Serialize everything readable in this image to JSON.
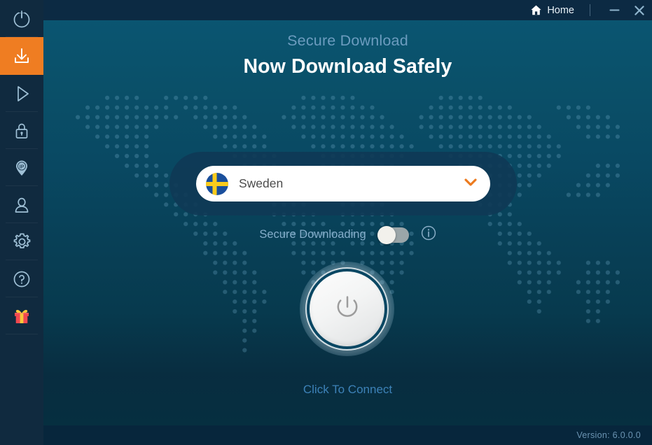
{
  "window": {
    "home_label": "Home",
    "minimize_label": "Minimize",
    "close_label": "Close"
  },
  "sidebar": {
    "items": [
      {
        "id": "power",
        "icon": "power-icon",
        "label": "Power",
        "active": false
      },
      {
        "id": "download",
        "icon": "download-icon",
        "label": "Secure Download",
        "active": true
      },
      {
        "id": "stream",
        "icon": "play-icon",
        "label": "Streaming",
        "active": false
      },
      {
        "id": "lock",
        "icon": "lock-icon",
        "label": "Security",
        "active": false
      },
      {
        "id": "ip",
        "icon": "ip-pin-icon",
        "label": "IP Location",
        "active": false
      },
      {
        "id": "account",
        "icon": "user-icon",
        "label": "Account",
        "active": false
      },
      {
        "id": "settings",
        "icon": "gear-icon",
        "label": "Settings",
        "active": false
      },
      {
        "id": "help",
        "icon": "question-icon",
        "label": "Help",
        "active": false
      },
      {
        "id": "gift",
        "icon": "gift-icon",
        "label": "Gift",
        "active": false
      }
    ]
  },
  "main": {
    "subtitle": "Secure Download",
    "title": "Now Download Safely",
    "country": {
      "name": "Sweden",
      "flag": "sweden-flag-icon",
      "chevron": "chevron-down-icon"
    },
    "secure_downloading": {
      "label": "Secure Downloading",
      "enabled": false,
      "info_icon": "info-icon"
    },
    "power_button": {
      "icon": "power-icon",
      "state": "disconnected"
    },
    "connect_text": "Click To Connect"
  },
  "footer": {
    "version_label": "Version:",
    "version_value": "6.0.0.0",
    "version_text": "Version:  6.0.0.0"
  },
  "colors": {
    "accent": "#ef7d22",
    "sidebar_bg": "#102a3f",
    "titlebar_bg": "#0c2a43",
    "stage_top": "#0a5571",
    "stage_bottom": "#062f40",
    "footer_bg": "#07263c",
    "subtitle": "#6c9cbf",
    "connect_text": "#3d82b8"
  }
}
